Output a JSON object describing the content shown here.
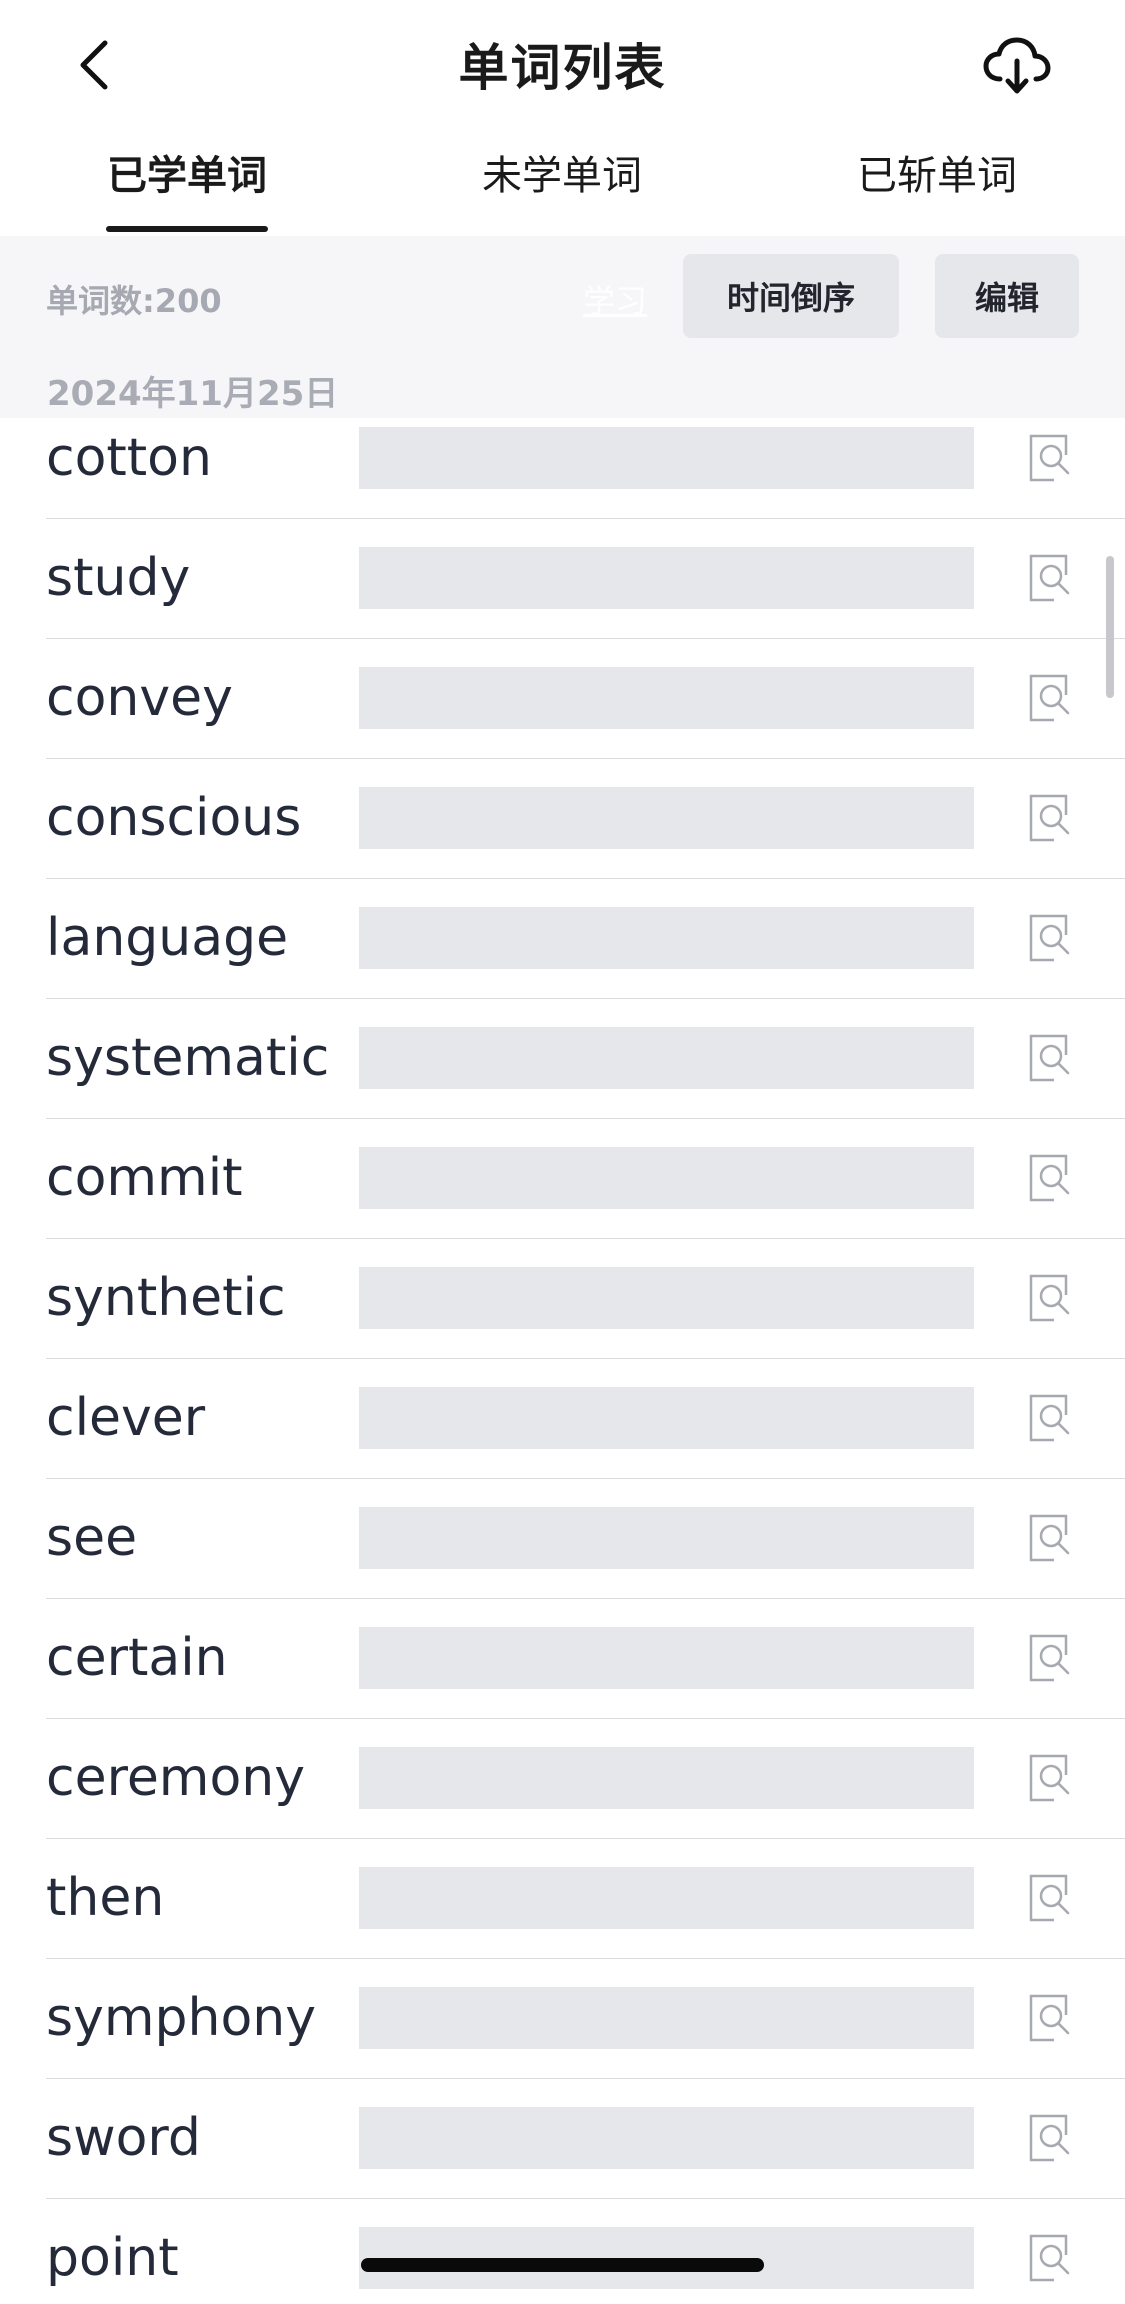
{
  "header": {
    "title": "单词列表",
    "back_icon": "chevron-left-icon",
    "download_icon": "cloud-download-icon"
  },
  "tabs": [
    {
      "label": "已学单词",
      "active": true
    },
    {
      "label": "未学单词",
      "active": false
    },
    {
      "label": "已斩单词",
      "active": false
    }
  ],
  "toolbar": {
    "word_count": "单词数:200",
    "learn_label": "学习",
    "sort_label": "时间倒序",
    "edit_label": "编辑"
  },
  "date_group": "2024年11月25日",
  "words": [
    {
      "word": "cotton"
    },
    {
      "word": "study"
    },
    {
      "word": "convey"
    },
    {
      "word": "conscious"
    },
    {
      "word": "language"
    },
    {
      "word": "systematic"
    },
    {
      "word": "commit"
    },
    {
      "word": "synthetic"
    },
    {
      "word": "clever"
    },
    {
      "word": "see"
    },
    {
      "word": "certain"
    },
    {
      "word": "ceremony"
    },
    {
      "word": "then"
    },
    {
      "word": "symphony"
    },
    {
      "word": "sword"
    },
    {
      "word": "point"
    }
  ],
  "colors": {
    "meaning_mask": "#e6e7eb",
    "toolbar_bg": "#f6f6f8",
    "text_primary": "#252a3b",
    "text_muted": "#a6a8b2"
  }
}
